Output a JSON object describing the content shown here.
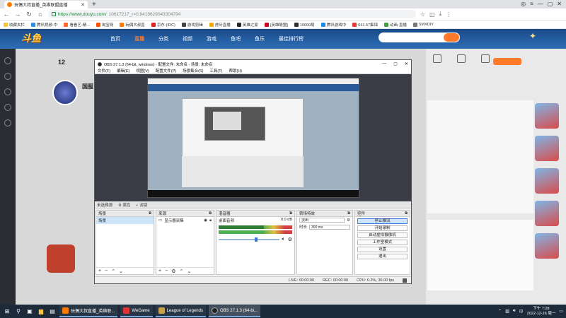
{
  "browser": {
    "tab_title": "玩偶大叔直播_英雄联盟直播",
    "url_main": "https://www.douyu.com/",
    "url_rest": "10617217_r=0.8419629043304794",
    "bookmarks": [
      "收藏夹栏",
      "腾讯视频-中",
      "看看艺-精...",
      "淘宝网",
      "玩偶大叔直",
      "京东·(IDC)",
      "游戏剪辑",
      "虎牙直播",
      "英雄之家",
      "[英雄联盟]",
      "10000局",
      "腾讯游戏中",
      "641.67集锦",
      "动画·直播",
      "SMXDIY"
    ]
  },
  "douyu": {
    "logo": "斗鱼",
    "nav": [
      "首页",
      "直播",
      "分类",
      "视频",
      "游戏",
      "鱼吧",
      "鱼乐",
      "最佳排行榜"
    ],
    "nav_active_index": 1,
    "room_level": "12",
    "anchor_name": "国服"
  },
  "obs": {
    "title": "OBS 27.1.3 (64-bit, windows) - 配置文件: 未命名 - 场景: 未命名",
    "menu": [
      "文件(F)",
      "编辑(E)",
      "视图(V)",
      "配置文件(P)",
      "场景集合(S)",
      "工具(T)",
      "帮助(H)"
    ],
    "source_bar": {
      "name": "未选择源",
      "props": "属性",
      "filters": "滤镜"
    },
    "scenes": {
      "title": "场景",
      "items": [
        "场景"
      ]
    },
    "sources": {
      "title": "来源",
      "items": [
        "显示器采集"
      ]
    },
    "mixer": {
      "title": "混音器",
      "channel": "桌面音频",
      "level": "0.0 dB",
      "level_fraction": 0.62
    },
    "transitions": {
      "title": "转场特效",
      "type": "淡出",
      "duration_label": "时长",
      "duration": "300 ms"
    },
    "controls": {
      "title": "控件",
      "buttons": [
        "停止推流",
        "开始录制",
        "启动虚拟摄像机",
        "工作室模式",
        "设置",
        "退出"
      ]
    },
    "status": {
      "live": "LIVE: 00:00:00",
      "rec": "REC: 00:00:00",
      "cpu": "CPU: 0.2%, 30.00 fps"
    }
  },
  "taskbar": {
    "apps": [
      "玩偶大叔直播_英雄联...",
      "WeGame",
      "League of Legends",
      "OBS 27.1.3 (64-bi..."
    ],
    "time": "下午 7:28",
    "date": "2022-12-26 周一"
  }
}
